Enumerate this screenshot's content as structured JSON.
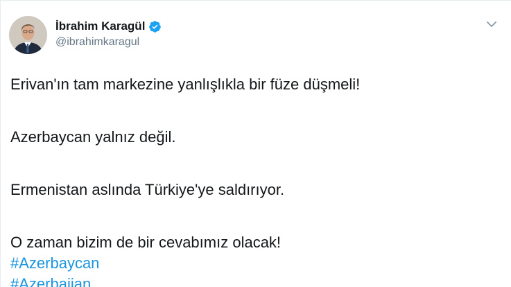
{
  "tweet": {
    "author_name": "İbrahim Karagül",
    "author_handle": "@ibrahimkaragul",
    "paragraphs": [
      "Erivan'ın tam markezine yanlışlıkla bir füze düşmeli!",
      "Azerbaycan yalnız değil.",
      "Ermenistan aslında Türkiye'ye saldırıyor.",
      "O zaman bizim de bir cevabımız olacak!"
    ],
    "hashtags": [
      "#Azerbaycan",
      "#Azerbaijan"
    ]
  },
  "icons": {
    "verified": "verified-badge-icon",
    "menu": "chevron-down-icon"
  },
  "colors": {
    "text": "#14171a",
    "muted": "#657786",
    "link": "#1b95e0",
    "verified": "#1da1f2"
  }
}
